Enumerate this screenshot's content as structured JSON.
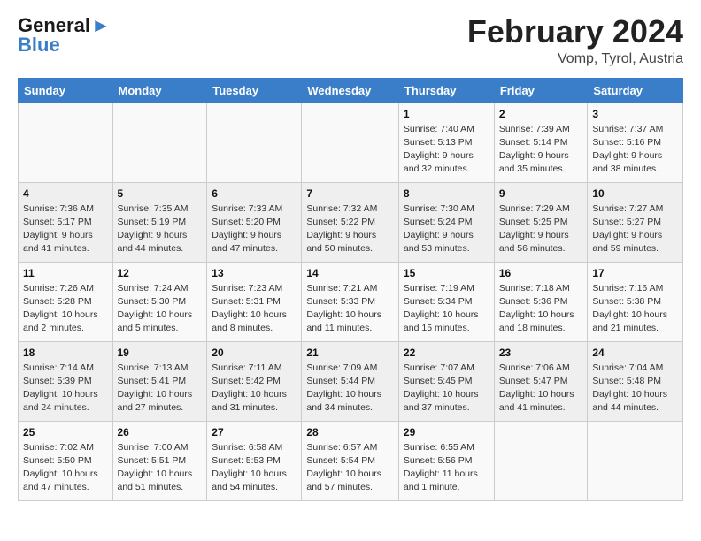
{
  "header": {
    "logo_general": "General",
    "logo_blue": "Blue",
    "title": "February 2024",
    "subtitle": "Vomp, Tyrol, Austria"
  },
  "columns": [
    "Sunday",
    "Monday",
    "Tuesday",
    "Wednesday",
    "Thursday",
    "Friday",
    "Saturday"
  ],
  "weeks": [
    [
      {
        "day": "",
        "info": ""
      },
      {
        "day": "",
        "info": ""
      },
      {
        "day": "",
        "info": ""
      },
      {
        "day": "",
        "info": ""
      },
      {
        "day": "1",
        "info": "Sunrise: 7:40 AM\nSunset: 5:13 PM\nDaylight: 9 hours\nand 32 minutes."
      },
      {
        "day": "2",
        "info": "Sunrise: 7:39 AM\nSunset: 5:14 PM\nDaylight: 9 hours\nand 35 minutes."
      },
      {
        "day": "3",
        "info": "Sunrise: 7:37 AM\nSunset: 5:16 PM\nDaylight: 9 hours\nand 38 minutes."
      }
    ],
    [
      {
        "day": "4",
        "info": "Sunrise: 7:36 AM\nSunset: 5:17 PM\nDaylight: 9 hours\nand 41 minutes."
      },
      {
        "day": "5",
        "info": "Sunrise: 7:35 AM\nSunset: 5:19 PM\nDaylight: 9 hours\nand 44 minutes."
      },
      {
        "day": "6",
        "info": "Sunrise: 7:33 AM\nSunset: 5:20 PM\nDaylight: 9 hours\nand 47 minutes."
      },
      {
        "day": "7",
        "info": "Sunrise: 7:32 AM\nSunset: 5:22 PM\nDaylight: 9 hours\nand 50 minutes."
      },
      {
        "day": "8",
        "info": "Sunrise: 7:30 AM\nSunset: 5:24 PM\nDaylight: 9 hours\nand 53 minutes."
      },
      {
        "day": "9",
        "info": "Sunrise: 7:29 AM\nSunset: 5:25 PM\nDaylight: 9 hours\nand 56 minutes."
      },
      {
        "day": "10",
        "info": "Sunrise: 7:27 AM\nSunset: 5:27 PM\nDaylight: 9 hours\nand 59 minutes."
      }
    ],
    [
      {
        "day": "11",
        "info": "Sunrise: 7:26 AM\nSunset: 5:28 PM\nDaylight: 10 hours\nand 2 minutes."
      },
      {
        "day": "12",
        "info": "Sunrise: 7:24 AM\nSunset: 5:30 PM\nDaylight: 10 hours\nand 5 minutes."
      },
      {
        "day": "13",
        "info": "Sunrise: 7:23 AM\nSunset: 5:31 PM\nDaylight: 10 hours\nand 8 minutes."
      },
      {
        "day": "14",
        "info": "Sunrise: 7:21 AM\nSunset: 5:33 PM\nDaylight: 10 hours\nand 11 minutes."
      },
      {
        "day": "15",
        "info": "Sunrise: 7:19 AM\nSunset: 5:34 PM\nDaylight: 10 hours\nand 15 minutes."
      },
      {
        "day": "16",
        "info": "Sunrise: 7:18 AM\nSunset: 5:36 PM\nDaylight: 10 hours\nand 18 minutes."
      },
      {
        "day": "17",
        "info": "Sunrise: 7:16 AM\nSunset: 5:38 PM\nDaylight: 10 hours\nand 21 minutes."
      }
    ],
    [
      {
        "day": "18",
        "info": "Sunrise: 7:14 AM\nSunset: 5:39 PM\nDaylight: 10 hours\nand 24 minutes."
      },
      {
        "day": "19",
        "info": "Sunrise: 7:13 AM\nSunset: 5:41 PM\nDaylight: 10 hours\nand 27 minutes."
      },
      {
        "day": "20",
        "info": "Sunrise: 7:11 AM\nSunset: 5:42 PM\nDaylight: 10 hours\nand 31 minutes."
      },
      {
        "day": "21",
        "info": "Sunrise: 7:09 AM\nSunset: 5:44 PM\nDaylight: 10 hours\nand 34 minutes."
      },
      {
        "day": "22",
        "info": "Sunrise: 7:07 AM\nSunset: 5:45 PM\nDaylight: 10 hours\nand 37 minutes."
      },
      {
        "day": "23",
        "info": "Sunrise: 7:06 AM\nSunset: 5:47 PM\nDaylight: 10 hours\nand 41 minutes."
      },
      {
        "day": "24",
        "info": "Sunrise: 7:04 AM\nSunset: 5:48 PM\nDaylight: 10 hours\nand 44 minutes."
      }
    ],
    [
      {
        "day": "25",
        "info": "Sunrise: 7:02 AM\nSunset: 5:50 PM\nDaylight: 10 hours\nand 47 minutes."
      },
      {
        "day": "26",
        "info": "Sunrise: 7:00 AM\nSunset: 5:51 PM\nDaylight: 10 hours\nand 51 minutes."
      },
      {
        "day": "27",
        "info": "Sunrise: 6:58 AM\nSunset: 5:53 PM\nDaylight: 10 hours\nand 54 minutes."
      },
      {
        "day": "28",
        "info": "Sunrise: 6:57 AM\nSunset: 5:54 PM\nDaylight: 10 hours\nand 57 minutes."
      },
      {
        "day": "29",
        "info": "Sunrise: 6:55 AM\nSunset: 5:56 PM\nDaylight: 11 hours\nand 1 minute."
      },
      {
        "day": "",
        "info": ""
      },
      {
        "day": "",
        "info": ""
      }
    ]
  ]
}
